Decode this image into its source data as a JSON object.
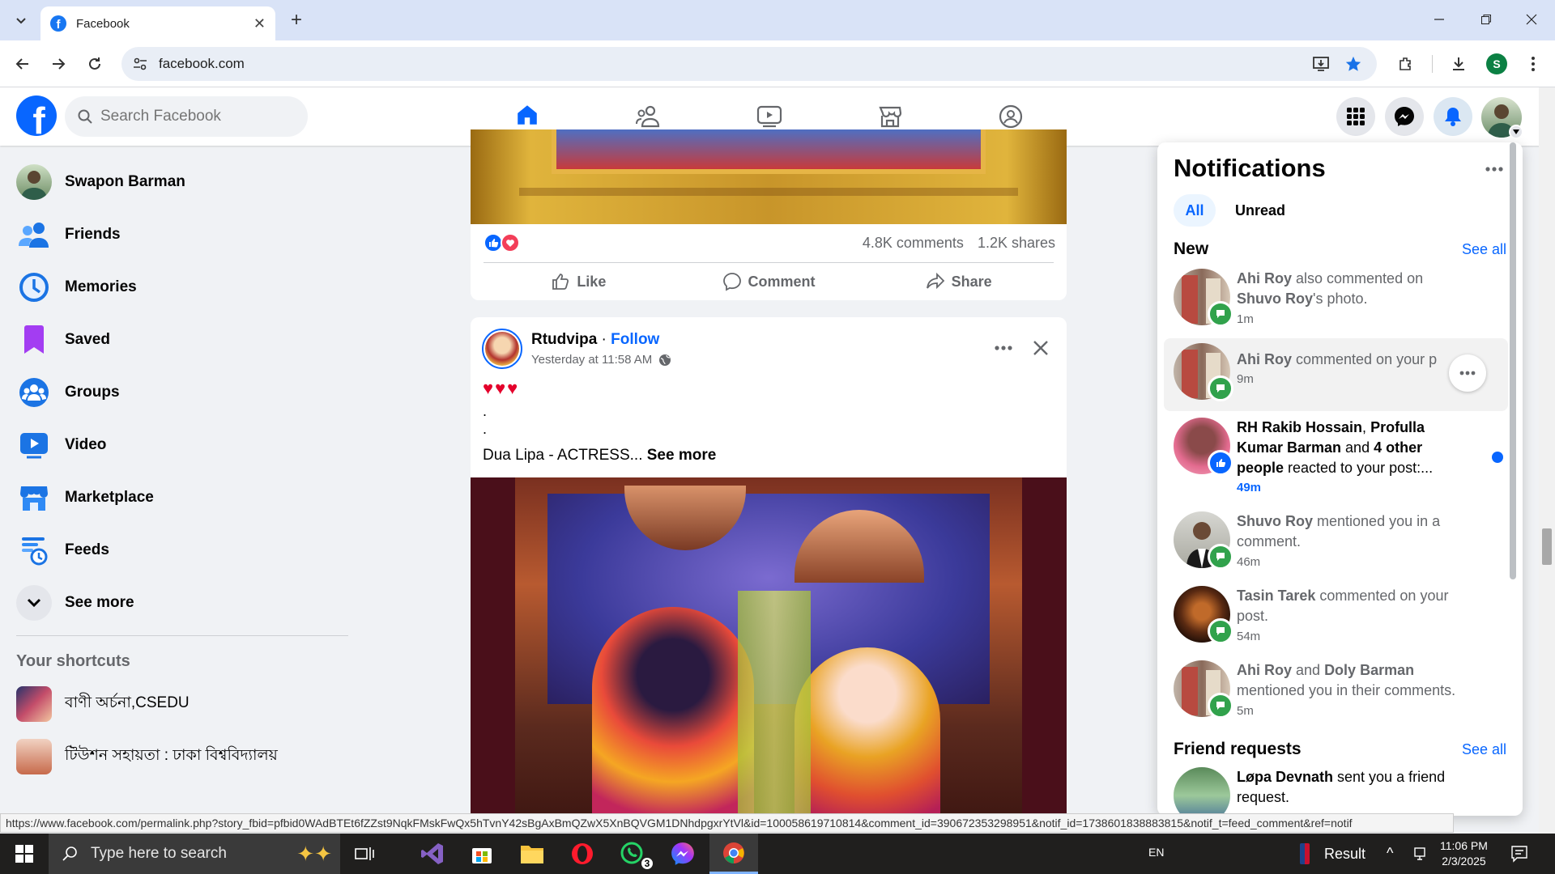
{
  "browser": {
    "tab_title": "Facebook",
    "url": "facebook.com",
    "profile_initial": "S"
  },
  "facebook": {
    "logo_letter": "f",
    "search_placeholder": "Search Facebook"
  },
  "sidebar": {
    "items": [
      {
        "label": "Swapon Barman",
        "icon": "profile-avatar"
      },
      {
        "label": "Friends",
        "icon": "friends-icon"
      },
      {
        "label": "Memories",
        "icon": "memories-icon"
      },
      {
        "label": "Saved",
        "icon": "saved-icon"
      },
      {
        "label": "Groups",
        "icon": "groups-icon"
      },
      {
        "label": "Video",
        "icon": "video-icon"
      },
      {
        "label": "Marketplace",
        "icon": "marketplace-icon"
      },
      {
        "label": "Feeds",
        "icon": "feeds-icon"
      },
      {
        "label": "See more",
        "icon": "chevron-down-icon"
      }
    ],
    "shortcuts_title": "Your shortcuts",
    "shortcuts": [
      {
        "label": "বাণী অর্চনা,CSEDU"
      },
      {
        "label": "টিউশন সহায়তা : ঢাকা বিশ্ববিদ্যালয়"
      }
    ]
  },
  "post1": {
    "comments": "4.8K comments",
    "shares": "1.2K shares",
    "like_label": "Like",
    "comment_label": "Comment",
    "share_label": "Share"
  },
  "post2": {
    "author": "Rtudvipa",
    "separator": " · ",
    "follow": "Follow",
    "time": "Yesterday at 11:58 AM",
    "hearts": "♥♥♥",
    "dot1": ".",
    "dot2": ".",
    "text": "Dua Lipa - ACTRESS...",
    "see_more": "See more"
  },
  "notifications": {
    "title": "Notifications",
    "tab_all": "All",
    "tab_unread": "Unread",
    "new_label": "New",
    "see_all": "See all",
    "items": [
      {
        "pre": "Ahi Roy",
        "mid": " also commented on ",
        "post": "Shuvo Roy",
        "end": "'s photo.",
        "time": "1m"
      },
      {
        "pre": "Ahi Roy",
        "mid": " commented on your p",
        "time": "9m"
      },
      {
        "pre": "RH Rakib Hossain",
        "mid": ", ",
        "post": "Profulla Kumar Barman",
        "and": " and ",
        "other": "4 other people",
        "end": " reacted to your post:...",
        "time": "49m"
      },
      {
        "pre": "Shuvo Roy",
        "mid": " mentioned you in a comment.",
        "time": "46m"
      },
      {
        "pre": "Tasin Tarek",
        "mid": " commented on your post.",
        "time": "54m"
      },
      {
        "pre": "Ahi Roy",
        "mid": " and ",
        "post": "Doly Barman",
        "end": " mentioned you in their comments.",
        "time": "5m"
      }
    ],
    "friend_requests_label": "Friend requests",
    "fr_see_all": "See all",
    "friend_request": {
      "name": "Løpa Devnath",
      "text": " sent you a friend request."
    }
  },
  "status_url": "https://www.facebook.com/permalink.php?story_fbid=pfbid0WAdBTEt6fZZst9NqkFMskFwQx5hTvnY42sBgAxBmQZwX5XnBQVGM1DNhdpgxrYtVl&id=100058619710814&comment_id=390672353298951&notif_id=1738601838883815&notif_t=feed_comment&ref=notif",
  "taskbar": {
    "search_placeholder": "Type here to search",
    "whatsapp_badge": "3",
    "lang": "EN",
    "result_label": "Result",
    "time": "11:06 PM",
    "date": "2/3/2025"
  },
  "colors": {
    "fb_blue": "#0866ff",
    "unread_dot": "#0866ff",
    "comment_badge": "#31a24c"
  }
}
